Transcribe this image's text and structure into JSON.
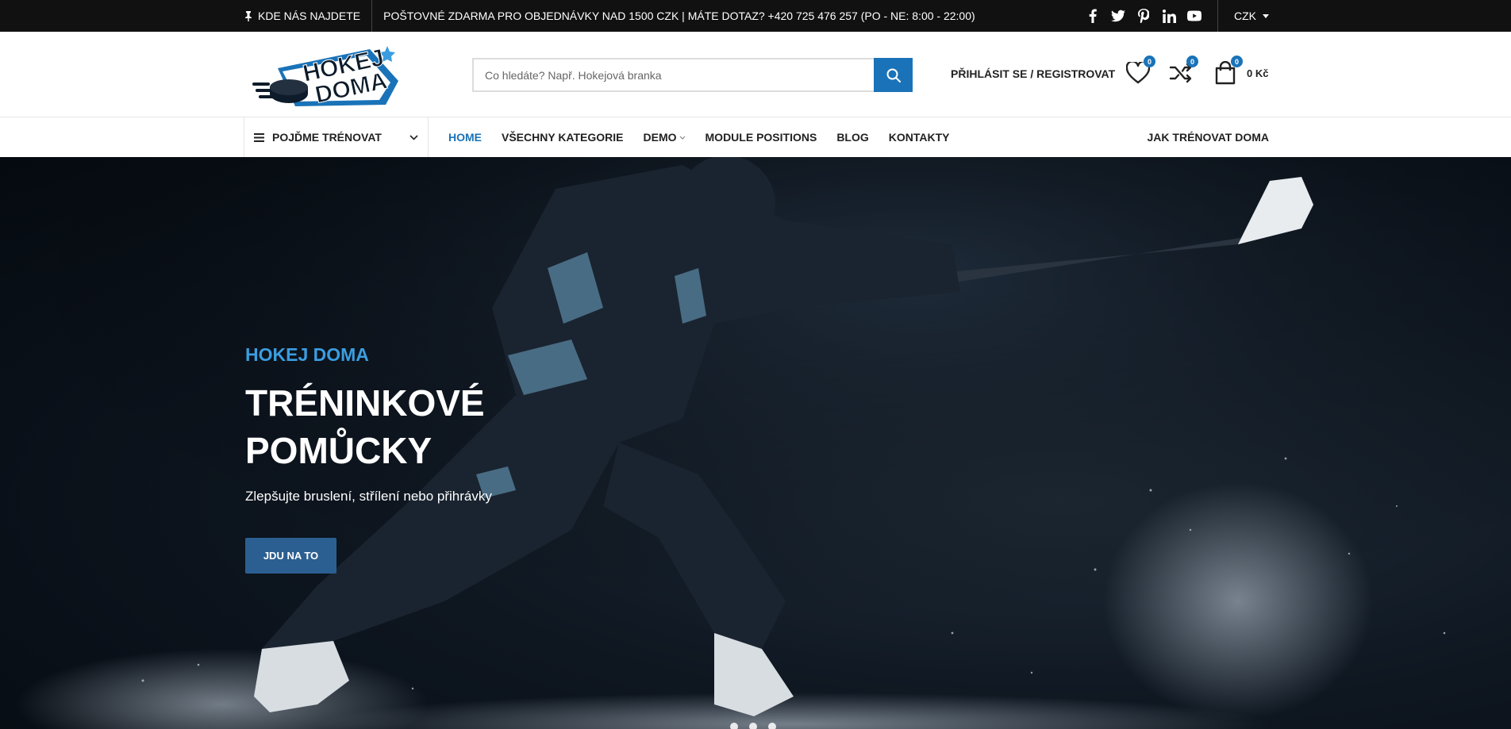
{
  "topbar": {
    "location_label": "KDE NÁS NAJDETE",
    "info": "POŠTOVNÉ ZDARMA PRO OBJEDNÁVKY NAD 1500 CZK | MÁTE DOTAZ? +420 725 476 257 (PO - NE: 8:00 - 22:00)",
    "social_icons": [
      "facebook-icon",
      "twitter-icon",
      "pinterest-icon",
      "linkedin-icon",
      "youtube-icon"
    ],
    "currency": "CZK"
  },
  "header": {
    "logo_text_top": "HOKEJ",
    "logo_text_bottom": "DOMA",
    "search_placeholder": "Co hledáte? Např. Hokejová branka",
    "login_label": "PŘIHLÁSIT SE / REGISTROVAT",
    "wishlist_count": "0",
    "compare_count": "0",
    "cart_count": "0",
    "cart_total": "0 Kč"
  },
  "nav": {
    "category_label": "POJĎME TRÉNOVAT",
    "items": [
      "HOME",
      "VŠECHNY KATEGORIE",
      "DEMO",
      "MODULE POSITIONS",
      "BLOG",
      "KONTAKTY"
    ],
    "right_link": "JAK TRÉNOVAT DOMA"
  },
  "hero": {
    "subtitle": "HOKEJ DOMA",
    "title": "TRÉNINKOVÉ POMŮCKY",
    "description": "Zlepšujte bruslení, střílení nebo přihrávky",
    "button_label": "JDU NA TO"
  },
  "colors": {
    "accent": "#1a73b8",
    "hero_subtitle": "#3b9de0",
    "hero_button": "#2c5f91",
    "topbar_bg": "#111111"
  }
}
